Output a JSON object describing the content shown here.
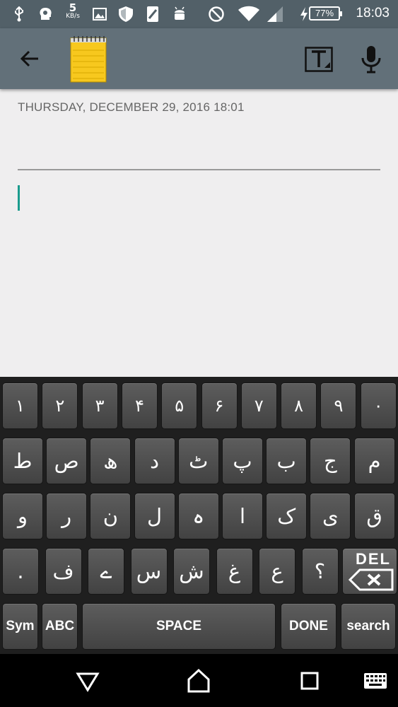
{
  "status_bar": {
    "net_speed_value": "5",
    "net_speed_unit": "KB/s",
    "battery": "77%",
    "time": "18:03"
  },
  "toolbar": {
    "back_icon": "arrow-left-icon",
    "app_icon": "notepad-icon",
    "text_format_icon": "text-format-icon",
    "mic_icon": "microphone-icon"
  },
  "note": {
    "date": "THURSDAY, DECEMBER 29, 2016 18:01",
    "title_value": "",
    "body_value": ""
  },
  "keyboard": {
    "rows": [
      [
        "١",
        "٢",
        "٣",
        "۴",
        "۵",
        "۶",
        "٧",
        "٨",
        "٩",
        "٠"
      ],
      [
        "ط",
        "ص",
        "ھ",
        "د",
        "ٹ",
        "پ",
        "ب",
        "ج",
        "م"
      ],
      [
        "و",
        "ر",
        "ن",
        "ل",
        "ہ",
        "ا",
        "ک",
        "ی",
        "ق"
      ],
      [
        ".",
        "ف",
        "ے",
        "س",
        "ش",
        "غ",
        "ع",
        "؟"
      ]
    ],
    "del_label": "DEL",
    "sym_label": "Sym",
    "abc_label": "ABC",
    "space_label": "SPACE",
    "done_label": "DONE",
    "search_label": "search"
  },
  "nav_bar": {
    "back_icon": "nav-back-icon",
    "home_icon": "nav-home-icon",
    "recents_icon": "nav-recents-icon",
    "keyboard_icon": "keyboard-switch-icon"
  }
}
